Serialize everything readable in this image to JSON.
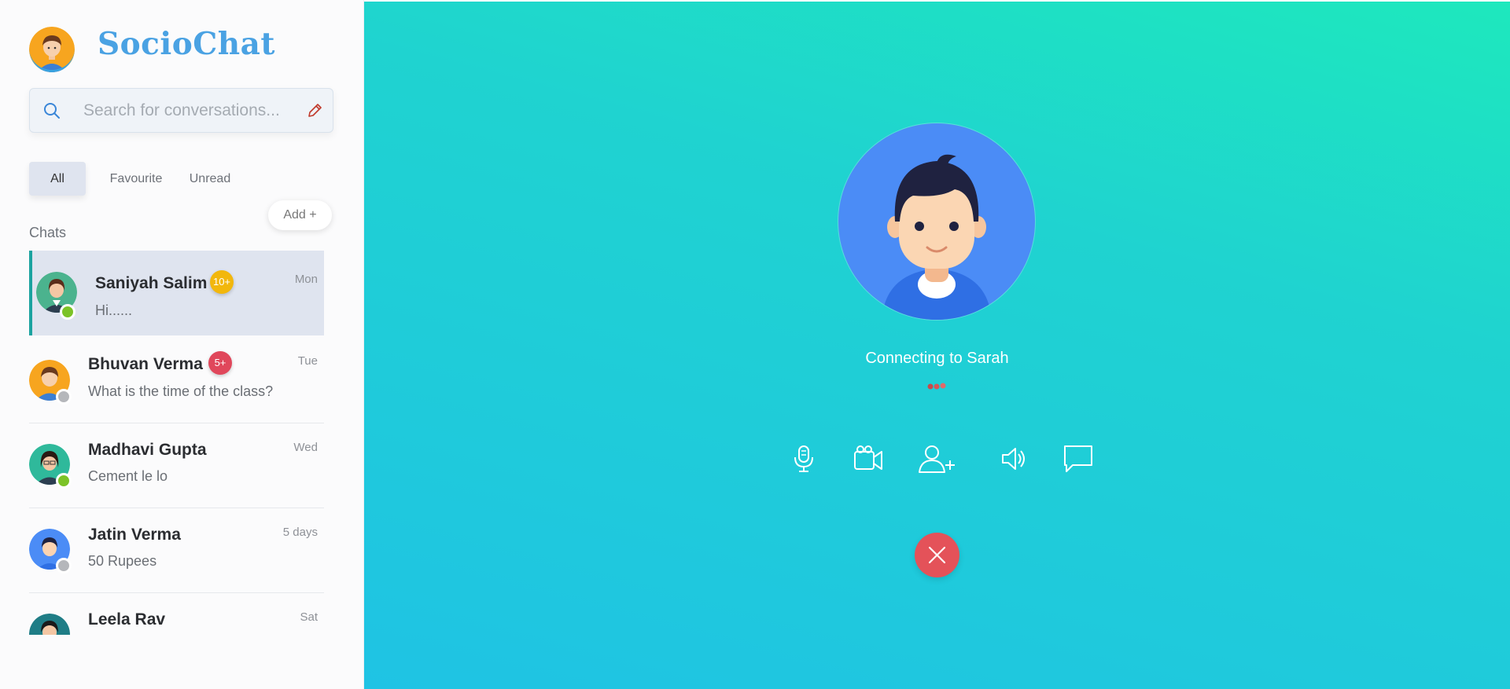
{
  "app": {
    "title": "SocioChat",
    "brand_color": "#4aa2e3"
  },
  "search": {
    "placeholder": "Search for conversations...",
    "value": ""
  },
  "tabs": [
    {
      "label": "All",
      "active": true
    },
    {
      "label": "Favourite",
      "active": false
    },
    {
      "label": "Unread",
      "active": false
    }
  ],
  "add_button": "Add +",
  "chats_label": "Chats",
  "chats": [
    {
      "name": "Saniyah Salim",
      "message": "Hi......",
      "time": "Mon",
      "badge": "10+",
      "badge_color": "#f2b70c",
      "status": "online",
      "active": true,
      "avatar": "woman-dark-hair"
    },
    {
      "name": "Bhuvan Verma",
      "message": "What is the time of the class?",
      "time": "Tue",
      "badge": "5+",
      "badge_color": "#e0475b",
      "status": "offline",
      "active": false,
      "avatar": "man-orange-bg"
    },
    {
      "name": "Madhavi Gupta",
      "message": "Cement le lo",
      "time": "Wed",
      "badge": "",
      "status": "online",
      "active": false,
      "avatar": "woman-glasses"
    },
    {
      "name": "Jatin Verma",
      "message": "50 Rupees",
      "time": "5 days",
      "badge": "",
      "status": "offline",
      "active": false,
      "avatar": "man-blue-bg"
    },
    {
      "name": "Leela Rav",
      "message": "",
      "time": "Sat",
      "badge": "",
      "status": "offline",
      "active": false,
      "avatar": "woman-teal-bg"
    }
  ],
  "call": {
    "status_text": "Connecting to Sarah",
    "controls": [
      "microphone-icon",
      "video-camera-icon",
      "add-user-icon",
      "speaker-icon",
      "chat-bubble-icon"
    ],
    "end_call_color": "#e45259"
  }
}
